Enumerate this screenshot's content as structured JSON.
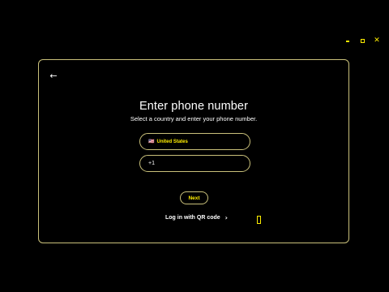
{
  "window": {
    "minimize_icon": "minimize-icon",
    "maximize_icon": "maximize-icon",
    "close_icon": "close-icon"
  },
  "panel": {
    "back_icon": "arrow-left-icon",
    "title": "Enter phone number",
    "subtitle": "Select a country and enter your phone number.",
    "country": {
      "flag": "🇺🇸",
      "value": "United States"
    },
    "phone": {
      "value": "+1"
    },
    "next_label": "Next",
    "qr_link_label": "Log in with QR code",
    "qr_chevron": "›"
  },
  "colors": {
    "background": "#000000",
    "accent": "#ffee00",
    "border": "#c9c07a",
    "text": "#ffffff"
  }
}
